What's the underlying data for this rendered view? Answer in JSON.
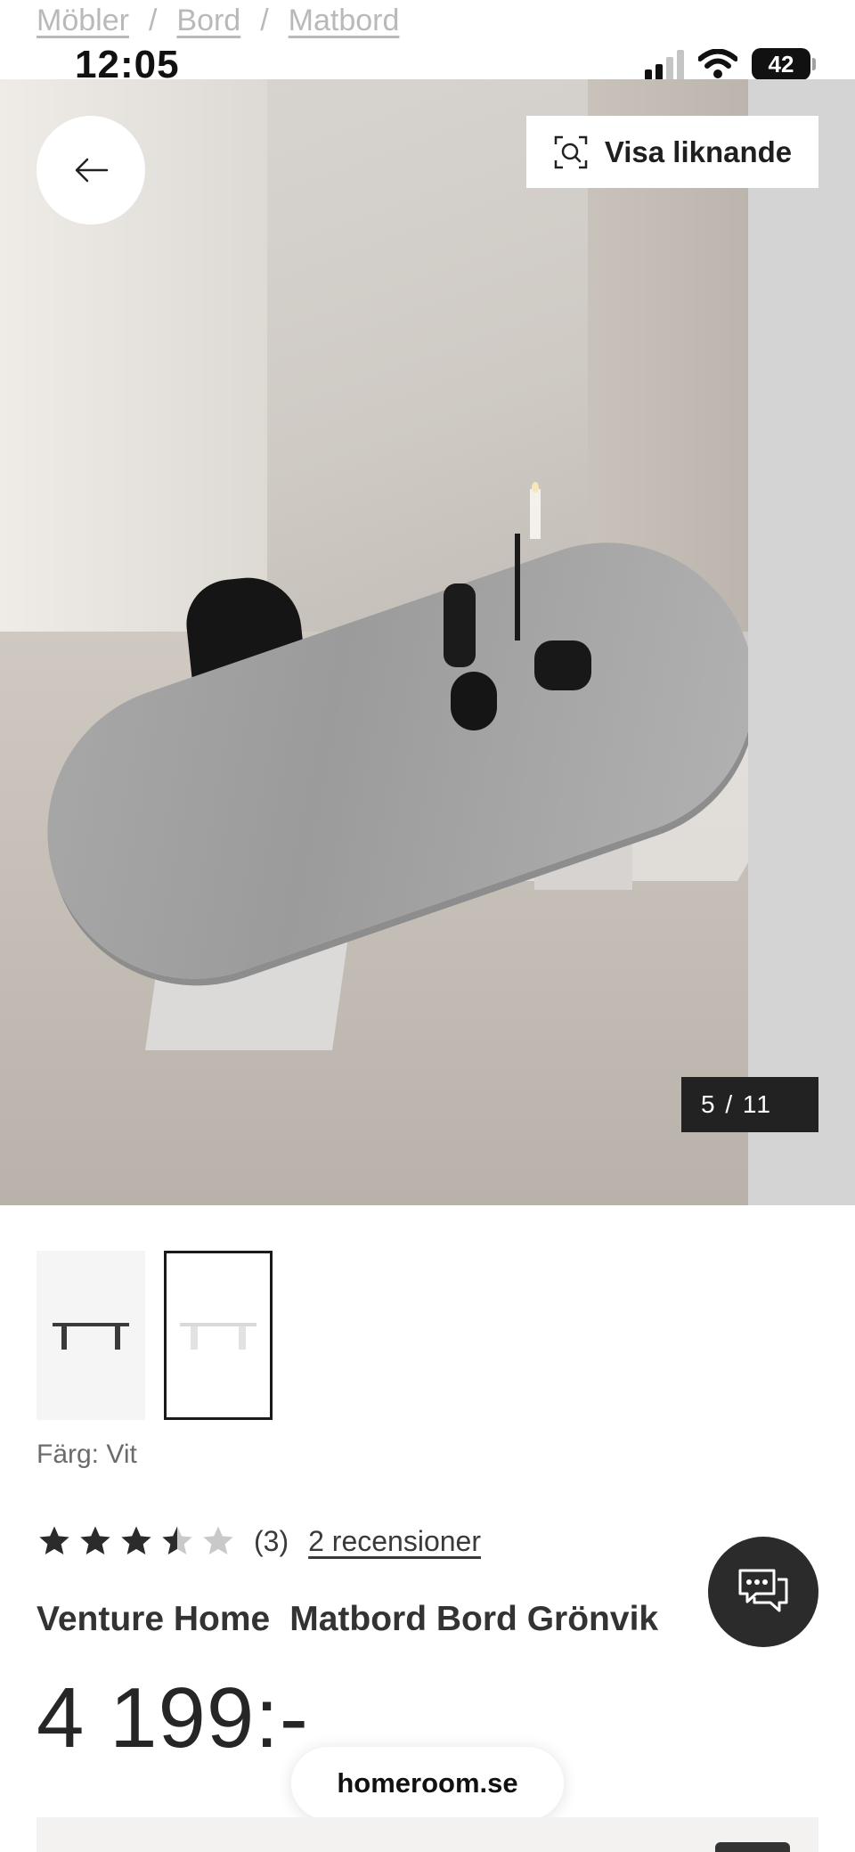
{
  "breadcrumb": {
    "items": [
      "Möbler",
      "Bord",
      "Matbord"
    ],
    "separator": "/"
  },
  "status_bar": {
    "time": "12:05",
    "battery": "42",
    "icons": [
      "signal-icon",
      "wifi-icon",
      "battery-icon"
    ]
  },
  "gallery": {
    "back_icon": "arrow-left-icon",
    "visa_label": "Visa liknande",
    "visa_icon": "visual-search-icon",
    "counter": "5 / 11"
  },
  "thumbnails": [
    {
      "name": "thumb-black",
      "selected": false
    },
    {
      "name": "thumb-white",
      "selected": true
    }
  ],
  "color": {
    "label": "Färg: Vit"
  },
  "rating": {
    "value": 3.5,
    "max": 5,
    "count_text": "(3)",
    "reviews_link": "2 recensioner"
  },
  "product": {
    "brand": "Venture Home",
    "name": "Matbord Bord Grönvik",
    "price": "4 199:-"
  },
  "chat": {
    "icon": "chat-bubbles-icon"
  },
  "browser": {
    "domain": "homeroom.se"
  },
  "colors": {
    "text": "#2b2b2b",
    "muted": "#b9b9b9",
    "dark": "#222222",
    "star_filled": "#2b2b2b",
    "star_empty": "#c9c9c9"
  }
}
